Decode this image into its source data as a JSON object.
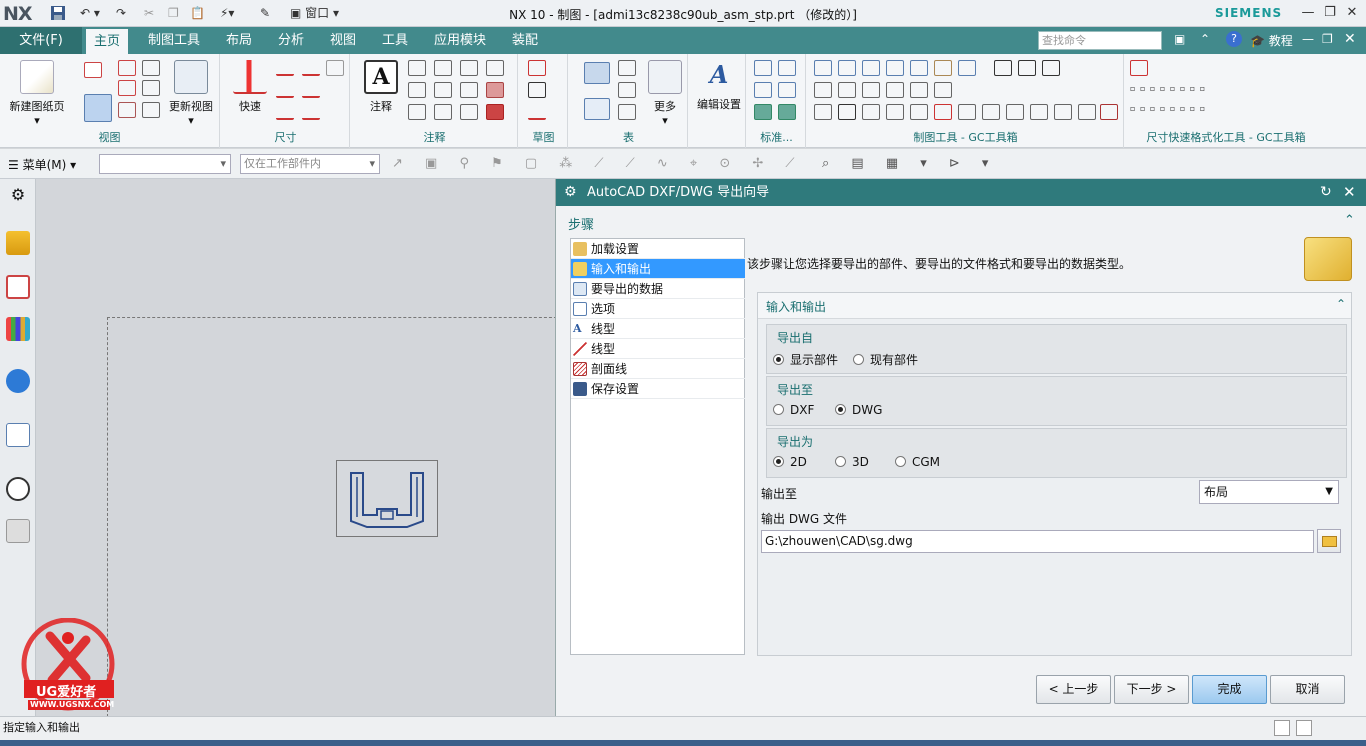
{
  "app": {
    "logo": "NX",
    "window_title": "NX 10 - 制图 - [admi13c8238c90ub_asm_stp.prt （修改的）]",
    "brand": "SIEMENS",
    "window_menu": "窗口"
  },
  "menubar": {
    "file": "文件(F)",
    "tabs": [
      "主页",
      "制图工具",
      "布局",
      "分析",
      "视图",
      "工具",
      "应用模块",
      "装配"
    ],
    "search_placeholder": "查找命令",
    "tutorial": "教程"
  },
  "ribbon": {
    "new_sheet": "新建图纸页",
    "update_view": "更新视图",
    "group_view": "视图",
    "quick": "快速",
    "group_dimension": "尺寸",
    "note": "注释",
    "group_annotation": "注释",
    "group_sketch": "草图",
    "more": "更多",
    "group_table": "表",
    "edit_settings": "编辑设置",
    "group_standard": "标准...",
    "group_gc": "制图工具 - GC工具箱",
    "group_dimfmt": "尺寸快速格式化工具 - GC工具箱"
  },
  "toolbar2": {
    "menu": "菜单(M)",
    "filter_placeholder": "",
    "scope": "仅在工作部件内"
  },
  "dialog": {
    "title": "AutoCAD DXF/DWG 导出向导",
    "section_steps": "步骤",
    "steps": [
      {
        "label": "加载设置",
        "icon": "wrench-icon",
        "selected": false
      },
      {
        "label": "输入和输出",
        "icon": "folder-icon",
        "selected": true
      },
      {
        "label": "要导出的数据",
        "icon": "data-icon",
        "selected": false
      },
      {
        "label": "选项",
        "icon": "checklist-icon",
        "selected": false
      },
      {
        "label": "线型",
        "icon": "text-style-icon",
        "selected": false
      },
      {
        "label": "线型",
        "icon": "line-icon",
        "selected": false
      },
      {
        "label": "剖面线",
        "icon": "hatch-icon",
        "selected": false
      },
      {
        "label": "保存设置",
        "icon": "save-icon",
        "selected": false
      }
    ],
    "description": "该步骤让您选择要导出的部件、要导出的文件格式和要导出的数据类型。",
    "io_section": "输入和输出",
    "export_from": {
      "label": "导出自",
      "options": [
        "显示部件",
        "现有部件"
      ],
      "selected": 0
    },
    "export_to": {
      "label": "导出至",
      "options": [
        "DXF",
        "DWG"
      ],
      "selected": 1
    },
    "export_as": {
      "label": "导出为",
      "options": [
        "2D",
        "3D",
        "CGM"
      ],
      "selected": 0
    },
    "output_to_label": "输出至",
    "output_to_value": "布局",
    "dwg_file_label": "输出 DWG 文件",
    "dwg_file_value": "G:\\zhouwen\\CAD\\sg.dwg",
    "buttons": {
      "back": "< 上一步",
      "next": "下一步 >",
      "finish": "完成",
      "cancel": "取消"
    }
  },
  "status": {
    "text": "指定输入和输出"
  },
  "watermark": {
    "brand": "UG爱好者",
    "url": "WWW.UGSNX.COM"
  },
  "colors": {
    "teal": "#2f7a7c",
    "menubar": "#428a8c",
    "selection": "#3399ff",
    "accent_text": "#1a6f70"
  }
}
